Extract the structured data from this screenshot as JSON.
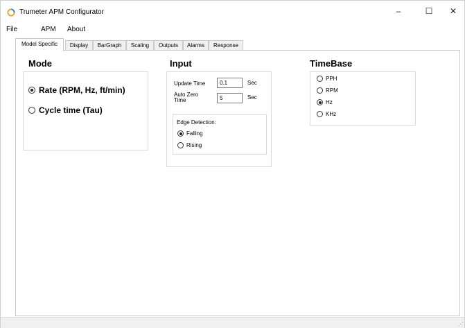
{
  "window": {
    "title": "Trumeter APM Configurator",
    "icon": "ring-icon",
    "controls": {
      "minimize": "–",
      "maximize": "☐",
      "close": "✕"
    }
  },
  "menu": [
    "File",
    "APM",
    "About"
  ],
  "tabs": [
    "Model Specific",
    "Display",
    "BarGraph",
    "Scaling",
    "Outputs",
    "Alarms",
    "Response"
  ],
  "active_tab": "Model Specific",
  "mode": {
    "heading": "Mode",
    "options": [
      {
        "label": "Rate (RPM, Hz, ft/min)",
        "checked": true
      },
      {
        "label": "Cycle time (Tau)",
        "checked": false
      }
    ]
  },
  "input": {
    "heading": "Input",
    "update_time": {
      "label": "Update Time",
      "value": "0.1",
      "unit": "Sec"
    },
    "auto_zero": {
      "label_line1": "Auto Zero",
      "label_line2": "Time",
      "value": "5",
      "unit": "Sec"
    },
    "edge_detection": {
      "label": "Edge Detection:",
      "options": [
        {
          "label": "Falling",
          "checked": true
        },
        {
          "label": "Rising",
          "checked": false
        }
      ]
    }
  },
  "timebase": {
    "heading": "TimeBase",
    "options": [
      {
        "label": "PPH",
        "checked": false
      },
      {
        "label": "RPM",
        "checked": false
      },
      {
        "label": "Hz",
        "checked": true
      },
      {
        "label": "KHz",
        "checked": false
      }
    ]
  },
  "colors": {
    "tab_inactive": "#f0f0f0",
    "border": "#c9c9c9",
    "accent_ring": "#e8a11c"
  }
}
